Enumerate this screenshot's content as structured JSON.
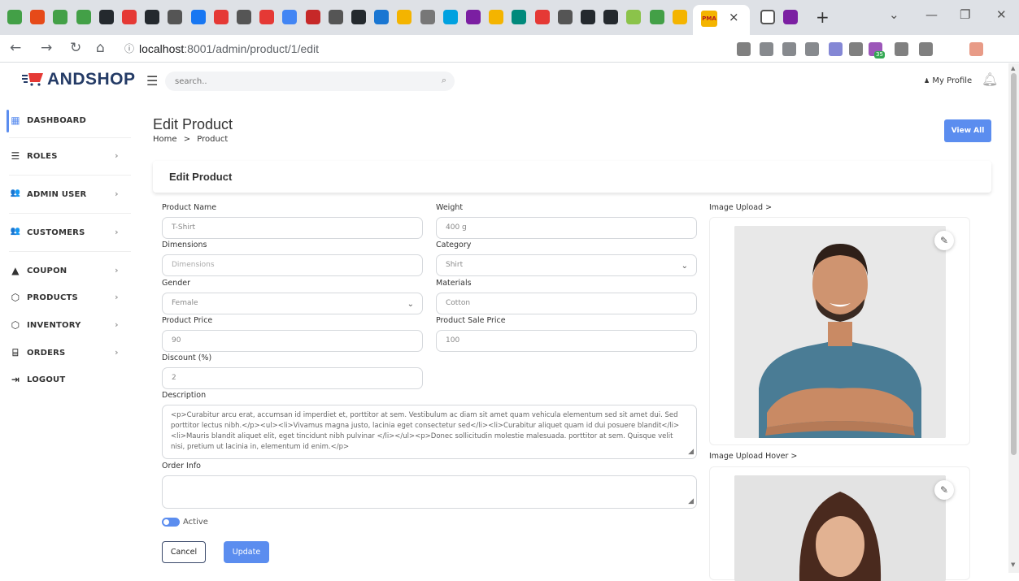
{
  "browser": {
    "url_host": "localhost",
    "url_rest": ":8001/admin/product/1/edit",
    "active_tab_close": "×",
    "new_tab": "+",
    "favicon_colors": [
      "#43a047",
      "#e64a19",
      "#43a047",
      "#43a047",
      "#24292e",
      "#e53935",
      "#24292e",
      "#555555",
      "#1877f2",
      "#e53935",
      "#555555",
      "#e53935",
      "#4285f4",
      "#c62828",
      "#555555",
      "#24292e",
      "#1976d2",
      "#f4b400",
      "#777777",
      "#00a1e0",
      "#7b1fa2",
      "#f4b400",
      "#00897b",
      "#e53935",
      "#555555",
      "#24292e",
      "#24292e",
      "#8bc34a",
      "#43a047",
      "#f4b400"
    ],
    "ext_colors": [
      "#555555",
      "#5f6368",
      "#5f6368",
      "#5f6368",
      "#5b5fc7",
      "#555555",
      "#7b1fa2",
      "#555555",
      "#555555",
      "#e07a5f"
    ],
    "badge": "35"
  },
  "header": {
    "brand": "ANDSHOP",
    "search_placeholder": "search..",
    "profile_label": "My Profile"
  },
  "sidebar": {
    "items": [
      {
        "label": "DASHBOARD",
        "icon": "dashboard-icon",
        "glyph": "▦",
        "chevron": ""
      },
      {
        "label": "ROLES",
        "icon": "list-icon",
        "glyph": "☰",
        "chevron": "›"
      },
      {
        "label": "ADMIN USER",
        "icon": "users-icon",
        "glyph": "👥",
        "chevron": "›"
      },
      {
        "label": "CUSTOMERS",
        "icon": "users-icon",
        "glyph": "👥",
        "chevron": "›"
      },
      {
        "label": "COUPON",
        "icon": "coupon-icon",
        "glyph": "▲",
        "chevron": "›"
      },
      {
        "label": "PRODUCTS",
        "icon": "box-icon",
        "glyph": "⬡",
        "chevron": "›"
      },
      {
        "label": "INVENTORY",
        "icon": "box-icon",
        "glyph": "⬡",
        "chevron": "›"
      },
      {
        "label": "ORDERS",
        "icon": "cart-icon",
        "glyph": "⌸",
        "chevron": "›"
      },
      {
        "label": "LOGOUT",
        "icon": "logout-icon",
        "glyph": "⇥",
        "chevron": ""
      }
    ]
  },
  "page": {
    "title": "Edit Product",
    "breadcrumb_home": "Home",
    "breadcrumb_sep": ">",
    "breadcrumb_current": "Product",
    "view_all": "View All",
    "card_title": "Edit Product"
  },
  "form": {
    "product_name": {
      "label": "Product Name",
      "value": "T-Shirt"
    },
    "weight": {
      "label": "Weight",
      "value": "400 g"
    },
    "dimensions": {
      "label": "Dimensions",
      "placeholder": "Dimensions"
    },
    "category": {
      "label": "Category",
      "value": "Shirt"
    },
    "gender": {
      "label": "Gender",
      "value": "Female"
    },
    "materials": {
      "label": "Materials",
      "value": "Cotton"
    },
    "price": {
      "label": "Product Price",
      "value": "90"
    },
    "sale_price": {
      "label": "Product Sale Price",
      "value": "100"
    },
    "discount": {
      "label": "Discount (%)",
      "value": "2"
    },
    "description": {
      "label": "Description",
      "value": "<p>Curabitur arcu erat, accumsan id imperdiet et, porttitor at sem. Vestibulum ac diam sit amet quam vehicula elementum sed sit amet dui. Sed porttitor lectus nibh.</p><ul><li>Vivamus magna justo, lacinia eget consectetur sed</li><li>Curabitur aliquet quam id dui posuere blandit</li><li>Mauris blandit aliquet elit, eget tincidunt nibh pulvinar </li></ul><p>Donec sollicitudin molestie malesuada. porttitor at sem. Quisque velit nisi, pretium ut lacinia in, elementum id enim.</p>"
    },
    "order_info": {
      "label": "Order Info",
      "value": ""
    },
    "active_label": "Active",
    "active": true,
    "cancel": "Cancel",
    "update": "Update",
    "image_upload": "Image Upload >",
    "image_upload_hover": "Image Upload Hover >"
  },
  "colors": {
    "accent": "#5b8def",
    "brand": "#243b66"
  }
}
